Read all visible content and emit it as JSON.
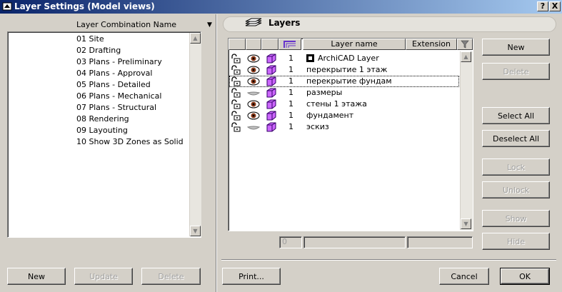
{
  "window": {
    "title": "Layer Settings (Model views)",
    "help_label": "?",
    "close_label": "X"
  },
  "left_panel": {
    "header": "Layer Combination Name",
    "combinations": [
      "01 Site",
      "02 Drafting",
      "03 Plans - Preliminary",
      "04 Plans - Approval",
      "05 Plans - Detailed",
      "06 Plans - Mechanical",
      "07 Plans - Structural",
      "08 Rendering",
      "09 Layouting",
      "10 Show 3D Zones as Solid"
    ],
    "buttons": {
      "new": "New",
      "update": "Update",
      "delete": "Delete"
    }
  },
  "right_panel": {
    "tab_title": "Layers",
    "columns": {
      "layer_name": "Layer name",
      "extension": "Extension"
    },
    "layers": [
      {
        "visible": true,
        "number": "1",
        "name": "ArchiCAD Layer",
        "has_icon": true
      },
      {
        "visible": true,
        "number": "1",
        "name": "перекрытие 1 этаж",
        "has_icon": false
      },
      {
        "visible": true,
        "number": "1",
        "name": "перекрытие фундам",
        "has_icon": false,
        "focused": true
      },
      {
        "visible": false,
        "number": "1",
        "name": "размеры",
        "has_icon": false
      },
      {
        "visible": true,
        "number": "1",
        "name": "стены 1 этажа",
        "has_icon": false
      },
      {
        "visible": true,
        "number": "1",
        "name": "фундамент",
        "has_icon": false
      },
      {
        "visible": false,
        "number": "1",
        "name": "эскиз",
        "has_icon": false
      }
    ],
    "footer_number_value": "0",
    "buttons": {
      "new": "New",
      "delete": "Delete",
      "select_all": "Select All",
      "deselect_all": "Deselect All",
      "lock": "Lock",
      "unlock": "Unlock",
      "show": "Show",
      "hide": "Hide"
    }
  },
  "bottom": {
    "print": "Print...",
    "cancel": "Cancel",
    "ok": "OK"
  },
  "colors": {
    "titlebar_start": "#0a246a",
    "titlebar_end": "#a6caf0",
    "dialog_bg": "#d4d0c8",
    "layer_icon": "#9933cc"
  }
}
